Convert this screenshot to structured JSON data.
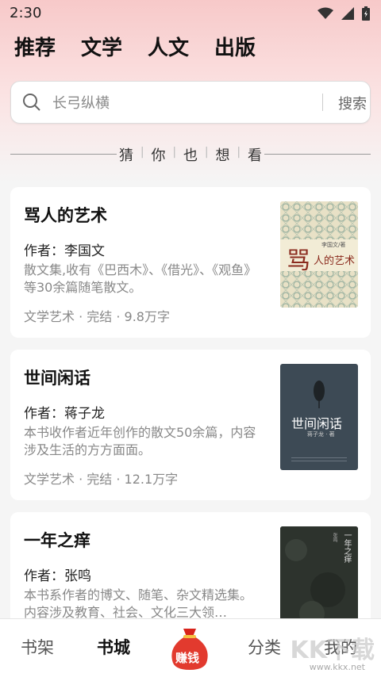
{
  "status_bar": {
    "time": "2:30"
  },
  "tabs": [
    "推荐",
    "文学",
    "人文",
    "出版"
  ],
  "search": {
    "placeholder": "长弓纵横",
    "button_label": "搜索"
  },
  "section": {
    "chars": [
      "猜",
      "你",
      "也",
      "想",
      "看"
    ]
  },
  "books": [
    {
      "title": "骂人的艺术",
      "author_label": "作者：",
      "author": "李国文",
      "desc": "散文集,收有《巴西木》、《借光》、《观鱼》等30余篇随笔散文。",
      "meta": "文学艺术 · 完结 · 9.8万字",
      "cover": {
        "title_main": "骂",
        "title_rest": "人的艺术",
        "small": "李国文/著",
        "bg": "#e9e2c8",
        "accent": "#8b2b1e"
      }
    },
    {
      "title": "世间闲话",
      "author_label": "作者：",
      "author": "蒋子龙",
      "desc": "本书收作者近年创作的散文50余篇，内容涉及生活的方方面面。",
      "meta": "文学艺术 · 完结 · 12.1万字",
      "cover": {
        "title": "世间闲话",
        "small": "蒋子龙 · 著",
        "bg": "#3d4a55"
      }
    },
    {
      "title": "一年之痒",
      "author_label": "作者：",
      "author": "张鸣",
      "desc": "本书系作者的博文、随笔、杂文精选集。内容涉及教育、社会、文化三大领…",
      "meta": "",
      "cover": {
        "title": "一年之痒",
        "small": "张鸣",
        "bg": "#2b302b"
      }
    }
  ],
  "bottom_nav": {
    "shelf": "书架",
    "store": "书城",
    "earn": "赚钱",
    "category": "分类",
    "mine": "我的"
  },
  "watermark": {
    "text": "KK下载",
    "url": "www.kkx.net"
  },
  "colors": {
    "accent_red": "#e23a2e",
    "bag_red": "#d8231b"
  }
}
